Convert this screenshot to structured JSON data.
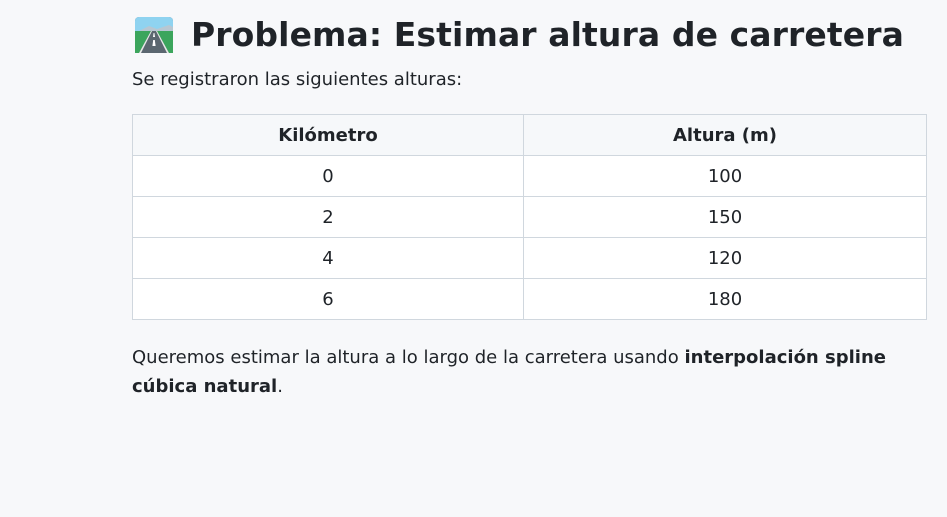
{
  "heading": {
    "icon": "road-icon",
    "title": "Problema: Estimar altura de carretera"
  },
  "intro_text": "Se registraron las siguientes alturas:",
  "table": {
    "headers": [
      "Kilómetro",
      "Altura (m)"
    ],
    "rows": [
      [
        "0",
        "100"
      ],
      [
        "2",
        "150"
      ],
      [
        "4",
        "120"
      ],
      [
        "6",
        "180"
      ]
    ]
  },
  "outro": {
    "text_before": "Queremos estimar la altura a lo largo de la carretera usando ",
    "bold_text": "interpolación spline cúbica natural",
    "text_after": "."
  }
}
